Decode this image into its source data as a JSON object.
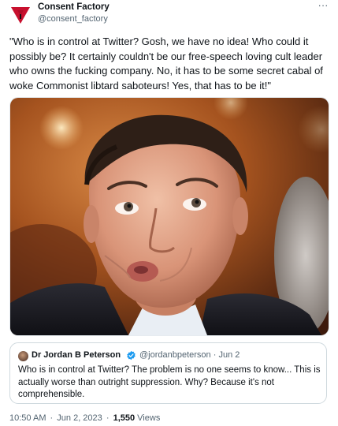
{
  "author": {
    "display_name": "Consent Factory",
    "handle": "@consent_factory",
    "avatar_icon": "red-triangle-logo",
    "avatar_color": "#c8102e"
  },
  "tweet": {
    "text": "\"Who is in control at Twitter? Gosh, we have no idea! Who could it possibly be? It certainly couldn't be our free-speech loving cult leader who owns the fucking company. No, it has to be some secret cabal of woke Commonist libtard saboteurs! Yes, that has to be it!\"",
    "more_icon": "more-options-icon",
    "more_label": "···"
  },
  "media": {
    "type": "photo",
    "icon": "photo-of-man-pursing-lips"
  },
  "quoted_tweet": {
    "display_name": "Dr Jordan B Peterson",
    "verified_icon": "verified-badge-icon",
    "verified_color": "#1d9bf0",
    "handle_and_date": "@jordanbpeterson · Jun 2",
    "text": "Who is in control at Twitter? The problem is no one seems to know... This is actually worse than outright suppression. Why? Because it's not comprehensible."
  },
  "meta": {
    "time": "10:50 AM",
    "separator": "·",
    "date": "Jun 2, 2023",
    "views_count": "1,550",
    "views_label": "Views"
  }
}
